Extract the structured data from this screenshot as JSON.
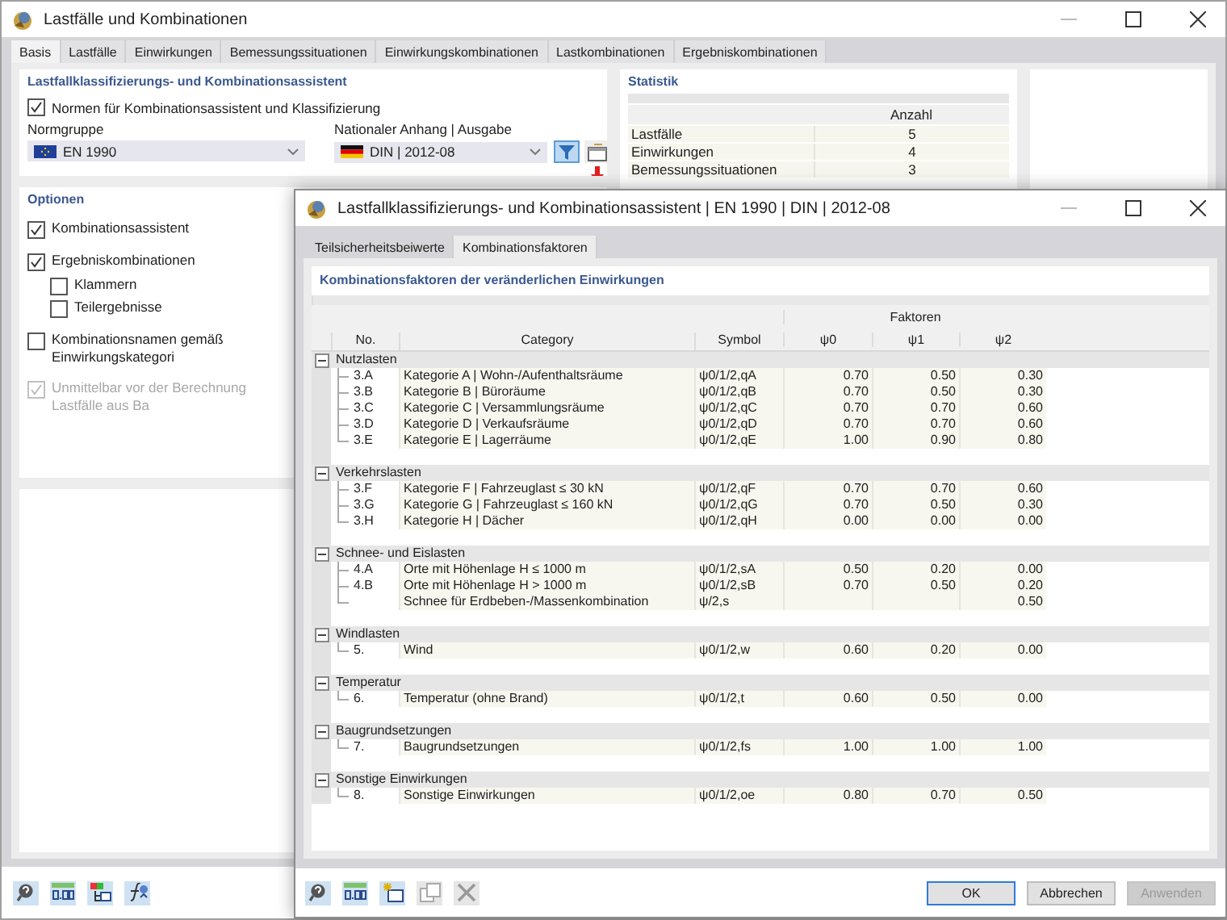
{
  "window": {
    "title": "Lastfälle und Kombinationen"
  },
  "tabs": [
    {
      "label": "Basis",
      "selected": true
    },
    {
      "label": "Lastfälle",
      "selected": false
    },
    {
      "label": "Einwirkungen",
      "selected": false
    },
    {
      "label": "Bemessungssituationen",
      "selected": false
    },
    {
      "label": "Einwirkungskombinationen",
      "selected": false
    },
    {
      "label": "Lastkombinationen",
      "selected": false
    },
    {
      "label": "Ergebniskombinationen",
      "selected": false
    }
  ],
  "classification": {
    "title": "Lastfallklassifizierungs- und Kombinationsassistent",
    "standards_checkbox": {
      "label": "Normen für Kombinationsassistent und Klassifizierung",
      "checked": true
    },
    "standard_group": {
      "label": "Normgruppe",
      "value": "EN 1990"
    },
    "national_annex": {
      "label": "Nationaler Anhang | Ausgabe",
      "value": "DIN | 2012-08"
    },
    "filter_button": {
      "selected": true
    }
  },
  "statistics": {
    "title": "Statistik",
    "columns": [
      "Anzahl"
    ],
    "rows": [
      {
        "label": "Lastfälle",
        "count": "5"
      },
      {
        "label": "Einwirkungen",
        "count": "4"
      },
      {
        "label": "Bemessungssituationen",
        "count": "3"
      }
    ]
  },
  "options": {
    "title": "Optionen",
    "items": [
      {
        "label": "Kombinationsassistent",
        "checked": true,
        "disabled": false
      },
      {
        "label": "Ergebniskombinationen",
        "checked": true,
        "disabled": false,
        "children": [
          {
            "label": "Klammern",
            "checked": false,
            "disabled": false
          },
          {
            "label": "Teilergebnisse",
            "checked": false,
            "disabled": false
          }
        ]
      },
      {
        "label": "Kombinationsnamen gemäß Einwirkungskategori",
        "checked": false,
        "disabled": false
      },
      {
        "label": "Unmittelbar vor der Berechnung Lastfälle aus Ba",
        "checked": true,
        "disabled": true
      }
    ]
  },
  "dialog": {
    "title": "Lastfallklassifizierungs- und Kombinationsassistent | EN 1990 | DIN | 2012-08",
    "tabs": [
      {
        "label": "Teilsicherheitsbeiwerte",
        "selected": false
      },
      {
        "label": "Kombinationsfaktoren",
        "selected": true
      }
    ],
    "section_title": "Kombinationsfaktoren der veränderlichen Einwirkungen",
    "table": {
      "columns": [
        "No.",
        "Category",
        "Symbol"
      ],
      "factors_header": "Faktoren",
      "factor_columns": [
        "ψ0",
        "ψ1",
        "ψ2"
      ],
      "groups": [
        {
          "label": "Nutzlasten",
          "expanded": true,
          "rows": [
            {
              "no": "3.A",
              "category": "Kategorie A | Wohn-/Aufenthaltsräume",
              "symbol": "ψ0/1/2,qA",
              "psi0": "0.70",
              "psi1": "0.50",
              "psi2": "0.30"
            },
            {
              "no": "3.B",
              "category": "Kategorie B | Büroräume",
              "symbol": "ψ0/1/2,qB",
              "psi0": "0.70",
              "psi1": "0.50",
              "psi2": "0.30"
            },
            {
              "no": "3.C",
              "category": "Kategorie C | Versammlungsräume",
              "symbol": "ψ0/1/2,qC",
              "psi0": "0.70",
              "psi1": "0.70",
              "psi2": "0.60"
            },
            {
              "no": "3.D",
              "category": "Kategorie D | Verkaufsräume",
              "symbol": "ψ0/1/2,qD",
              "psi0": "0.70",
              "psi1": "0.70",
              "psi2": "0.60"
            },
            {
              "no": "3.E",
              "category": "Kategorie E | Lagerräume",
              "symbol": "ψ0/1/2,qE",
              "psi0": "1.00",
              "psi1": "0.90",
              "psi2": "0.80"
            }
          ]
        },
        {
          "label": "Verkehrslasten",
          "expanded": true,
          "rows": [
            {
              "no": "3.F",
              "category": "Kategorie F | Fahrzeuglast ≤ 30 kN",
              "symbol": "ψ0/1/2,qF",
              "psi0": "0.70",
              "psi1": "0.70",
              "psi2": "0.60"
            },
            {
              "no": "3.G",
              "category": "Kategorie G | Fahrzeuglast ≤ 160 kN",
              "symbol": "ψ0/1/2,qG",
              "psi0": "0.70",
              "psi1": "0.50",
              "psi2": "0.30"
            },
            {
              "no": "3.H",
              "category": "Kategorie H | Dächer",
              "symbol": "ψ0/1/2,qH",
              "psi0": "0.00",
              "psi1": "0.00",
              "psi2": "0.00"
            }
          ]
        },
        {
          "label": "Schnee- und Eislasten",
          "expanded": true,
          "rows": [
            {
              "no": "4.A",
              "category": "Orte mit Höhenlage H ≤ 1000 m",
              "symbol": "ψ0/1/2,sA",
              "psi0": "0.50",
              "psi1": "0.20",
              "psi2": "0.00"
            },
            {
              "no": "4.B",
              "category": "Orte mit Höhenlage H > 1000 m",
              "symbol": "ψ0/1/2,sB",
              "psi0": "0.70",
              "psi1": "0.50",
              "psi2": "0.20"
            },
            {
              "category": "Schnee für Erdbeben-/Massenkombination",
              "symbol": "ψ/2,s",
              "psi2": "0.50"
            }
          ]
        },
        {
          "label": "Windlasten",
          "expanded": true,
          "rows": [
            {
              "no": "5.",
              "category": "Wind",
              "symbol": "ψ0/1/2,w",
              "psi0": "0.60",
              "psi1": "0.20",
              "psi2": "0.00"
            }
          ]
        },
        {
          "label": "Temperatur",
          "expanded": true,
          "rows": [
            {
              "no": "6.",
              "category": "Temperatur (ohne Brand)",
              "symbol": "ψ0/1/2,t",
              "psi0": "0.60",
              "psi1": "0.50",
              "psi2": "0.00"
            }
          ]
        },
        {
          "label": "Baugrundsetzungen",
          "expanded": true,
          "rows": [
            {
              "no": "7.",
              "category": "Baugrundsetzungen",
              "symbol": "ψ0/1/2,fs",
              "psi0": "1.00",
              "psi1": "1.00",
              "psi2": "1.00"
            }
          ]
        },
        {
          "label": "Sonstige Einwirkungen",
          "expanded": true,
          "rows": [
            {
              "no": "8.",
              "category": "Sonstige Einwirkungen",
              "symbol": "ψ0/1/2,oe",
              "psi0": "0.80",
              "psi1": "0.70",
              "psi2": "0.50"
            }
          ]
        }
      ]
    },
    "toolbar": [
      {
        "disabled": false
      },
      {
        "disabled": false
      },
      {
        "disabled": false
      },
      {
        "disabled": true
      },
      {
        "disabled": true
      }
    ],
    "buttons": [
      {
        "label": "OK",
        "kind": "default",
        "disabled": false
      },
      {
        "label": "Abbrechen",
        "kind": "normal",
        "disabled": false
      },
      {
        "label": "Anwenden",
        "kind": "normal",
        "disabled": true
      }
    ]
  }
}
